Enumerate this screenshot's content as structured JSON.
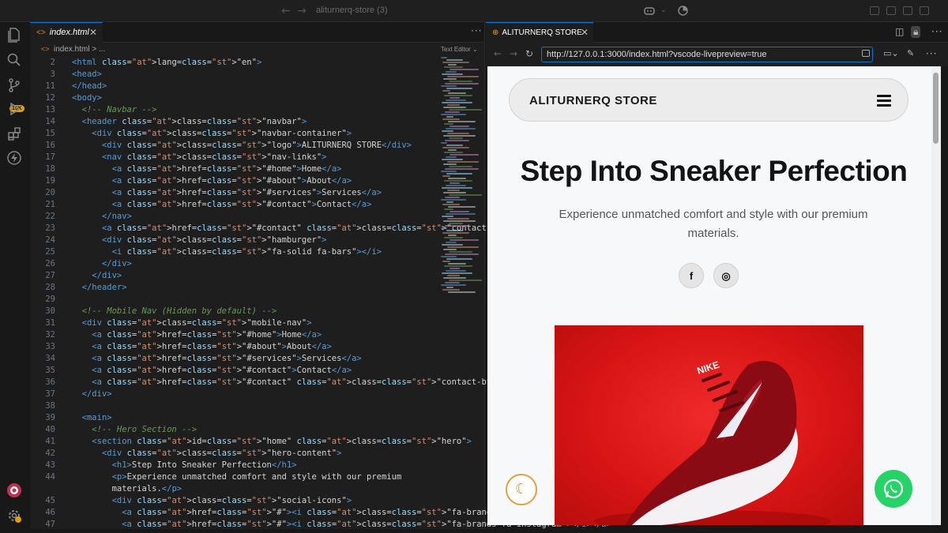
{
  "window": {
    "command_center": "aliturnerq-store (3)"
  },
  "activity": {
    "badge": "10K"
  },
  "editor": {
    "tab_label": "index.html",
    "breadcrumb_file": "index.html",
    "breadcrumb_rest": "> ...",
    "text_editor_label": "Text Editor",
    "lines": [
      {
        "n": "2",
        "src": "<html lang=\"en\">"
      },
      {
        "n": "3",
        "src": "<head>"
      },
      {
        "n": "11",
        "src": "</head>"
      },
      {
        "n": "12",
        "src": "<body>"
      },
      {
        "n": "13",
        "src": "  <!-- Navbar -->"
      },
      {
        "n": "14",
        "src": "  <header class=\"navbar\">"
      },
      {
        "n": "15",
        "src": "    <div class=\"navbar-container\">"
      },
      {
        "n": "16",
        "src": "      <div class=\"logo\">ALITURNERQ STORE</div>"
      },
      {
        "n": "17",
        "src": "      <nav class=\"nav-links\">"
      },
      {
        "n": "18",
        "src": "        <a href=\"#home\">Home</a>"
      },
      {
        "n": "19",
        "src": "        <a href=\"#about\">About</a>"
      },
      {
        "n": "20",
        "src": "        <a href=\"#services\">Services</a>"
      },
      {
        "n": "21",
        "src": "        <a href=\"#contact\">Contact</a>"
      },
      {
        "n": "22",
        "src": "      </nav>"
      },
      {
        "n": "23",
        "src": "      <a href=\"#contact\" class=\"contact-btn\">Contact Us</a>"
      },
      {
        "n": "24",
        "src": "      <div class=\"hamburger\">"
      },
      {
        "n": "25",
        "src": "        <i class=\"fa-solid fa-bars\"></i>"
      },
      {
        "n": "26",
        "src": "      </div>"
      },
      {
        "n": "27",
        "src": "    </div>"
      },
      {
        "n": "28",
        "src": "  </header>"
      },
      {
        "n": "29",
        "src": ""
      },
      {
        "n": "30",
        "src": "  <!-- Mobile Nav (Hidden by default) -->"
      },
      {
        "n": "31",
        "src": "  <div class=\"mobile-nav\">"
      },
      {
        "n": "32",
        "src": "    <a href=\"#home\">Home</a>"
      },
      {
        "n": "33",
        "src": "    <a href=\"#about\">About</a>"
      },
      {
        "n": "34",
        "src": "    <a href=\"#services\">Services</a>"
      },
      {
        "n": "35",
        "src": "    <a href=\"#contact\">Contact</a>"
      },
      {
        "n": "36",
        "src": "    <a href=\"#contact\" class=\"contact-btn-mobile\">Contact Us</a>"
      },
      {
        "n": "37",
        "src": "  </div>"
      },
      {
        "n": "38",
        "src": ""
      },
      {
        "n": "39",
        "src": "  <main>"
      },
      {
        "n": "40",
        "src": "    <!-- Hero Section -->"
      },
      {
        "n": "41",
        "src": "    <section id=\"home\" class=\"hero\">"
      },
      {
        "n": "42",
        "src": "      <div class=\"hero-content\">"
      },
      {
        "n": "43",
        "src": "        <h1>Step Into Sneaker Perfection</h1>"
      },
      {
        "n": "44",
        "src": "        <p>Experience unmatched comfort and style with our premium"
      },
      {
        "n": "",
        "src": "        materials.</p>"
      },
      {
        "n": "45",
        "src": "        <div class=\"social-icons\">"
      },
      {
        "n": "46",
        "src": "          <a href=\"#\"><i class=\"fa-brands fa-facebook-f\"></i></a>"
      },
      {
        "n": "47",
        "src": "          <a href=\"#\"><i class=\"fa-brands fa-instagram\"></i></a>"
      }
    ]
  },
  "preview": {
    "tab_label": "ALITURNERQ STORE",
    "url": "http://127.0.0.1:3000/index.html?vscode-livepreview=true",
    "site": {
      "logo": "ALITURNERQ STORE",
      "hero_title": "Step Into Sneaker Perfection",
      "hero_subtitle": "Experience unmatched comfort and style with our premium materials.",
      "social": [
        "f",
        "◎"
      ],
      "shoe_brand": "NIKE"
    }
  },
  "colors": {
    "accent": "#0078d4",
    "whatsapp": "#25d366",
    "hero_bg": "#d91515",
    "theme_toggle": "#e0a040"
  }
}
